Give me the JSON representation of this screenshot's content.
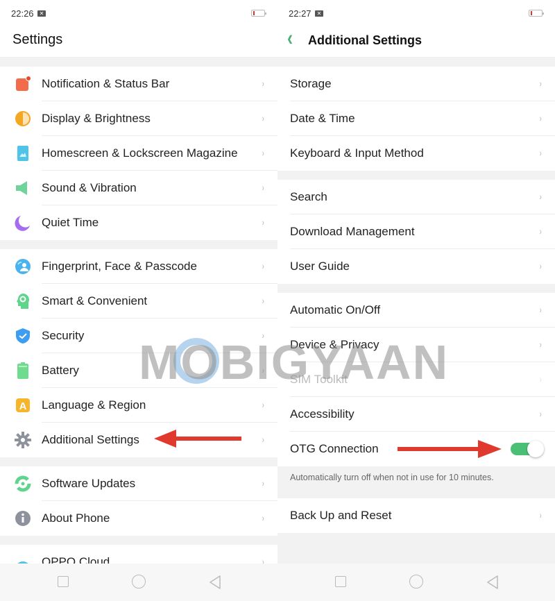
{
  "left": {
    "status": {
      "time": "22:26",
      "notif_icon": "x-notification-icon"
    },
    "title": "Settings",
    "groups": [
      [
        {
          "label": "Notification & Status Bar",
          "icon": "notification-icon",
          "color": "#f26b4a"
        },
        {
          "label": "Display & Brightness",
          "icon": "display-icon",
          "color": "#f5a623"
        },
        {
          "label": "Homescreen & Lockscreen Magazine",
          "icon": "homescreen-icon",
          "color": "#4fc3e8"
        },
        {
          "label": "Sound & Vibration",
          "icon": "sound-icon",
          "color": "#6fd39a"
        },
        {
          "label": "Quiet Time",
          "icon": "moon-icon",
          "color": "#a46cf0"
        }
      ],
      [
        {
          "label": "Fingerprint, Face & Passcode",
          "icon": "fingerprint-icon",
          "color": "#4ab3ef"
        },
        {
          "label": "Smart & Convenient",
          "icon": "smart-head-icon",
          "color": "#5ed48c"
        },
        {
          "label": "Security",
          "icon": "shield-icon",
          "color": "#3d9df0"
        },
        {
          "label": "Battery",
          "icon": "battery-icon",
          "color": "#6fdb8e"
        },
        {
          "label": "Language & Region",
          "icon": "language-icon",
          "color": "#f7b52c"
        },
        {
          "label": "Additional Settings",
          "icon": "gear-icon",
          "color": "#8e929c"
        }
      ],
      [
        {
          "label": "Software Updates",
          "icon": "update-icon",
          "color": "#5ed48c"
        },
        {
          "label": "About Phone",
          "icon": "info-icon",
          "color": "#8e929c"
        }
      ],
      [
        {
          "label": "OPPO Cloud",
          "icon": "cloud-icon",
          "color": "#4fc3e8"
        }
      ]
    ]
  },
  "right": {
    "status": {
      "time": "22:27",
      "notif_icon": "x-notification-icon"
    },
    "title": "Additional Settings",
    "groups": [
      [
        {
          "label": "Storage"
        },
        {
          "label": "Date & Time"
        },
        {
          "label": "Keyboard & Input Method"
        }
      ],
      [
        {
          "label": "Search"
        },
        {
          "label": "Download Management"
        },
        {
          "label": "User Guide"
        }
      ],
      [
        {
          "label": "Automatic On/Off"
        },
        {
          "label": "Device & Privacy"
        },
        {
          "label": "SIM Toolkit",
          "disabled": true
        },
        {
          "label": "Accessibility"
        },
        {
          "label": "OTG Connection",
          "toggle": true,
          "on": true
        }
      ]
    ],
    "otg_note": "Automatically turn off when not in use for 10 minutes.",
    "last_group": [
      {
        "label": "Back Up and Reset"
      }
    ]
  },
  "chevron": "›",
  "watermark": "MOBIGYAAN",
  "accent_color": "#4cbf76",
  "arrow_color": "#e0392e"
}
